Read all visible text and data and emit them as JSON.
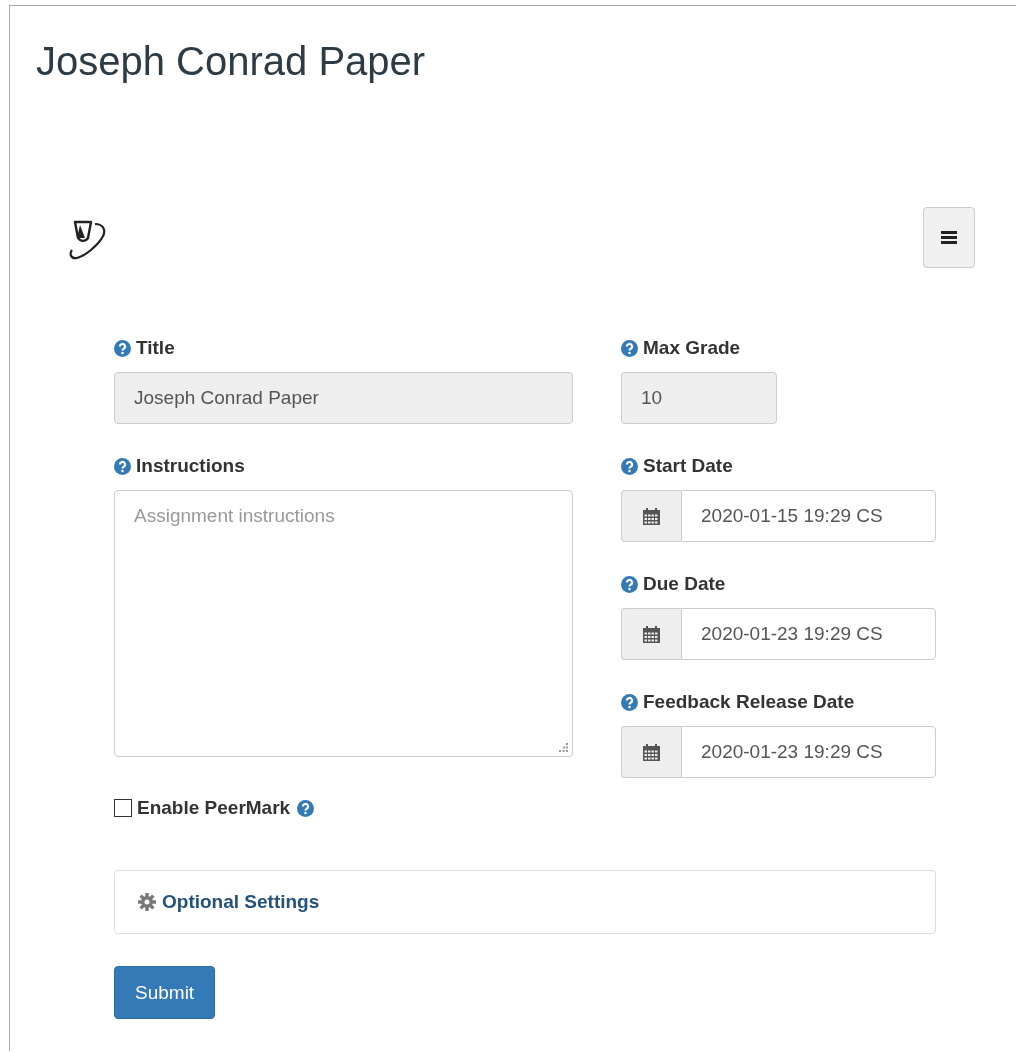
{
  "page_title": "Joseph Conrad Paper",
  "form": {
    "title": {
      "label": "Title",
      "value": "Joseph Conrad Paper",
      "disabled": true
    },
    "instructions": {
      "label": "Instructions",
      "placeholder": "Assignment instructions"
    },
    "max_grade": {
      "label": "Max Grade",
      "value": "10",
      "disabled": true
    },
    "dates": [
      {
        "label": "Start Date",
        "value": "2020-01-15 19:29 CS"
      },
      {
        "label": "Due Date",
        "value": "2020-01-23 19:29 CS"
      },
      {
        "label": "Feedback Release Date",
        "value": "2020-01-23 19:29 CS"
      }
    ],
    "peermark": {
      "label": "Enable PeerMark",
      "checked": false
    },
    "optional_settings": {
      "label": "Optional Settings"
    },
    "submit": "Submit"
  }
}
